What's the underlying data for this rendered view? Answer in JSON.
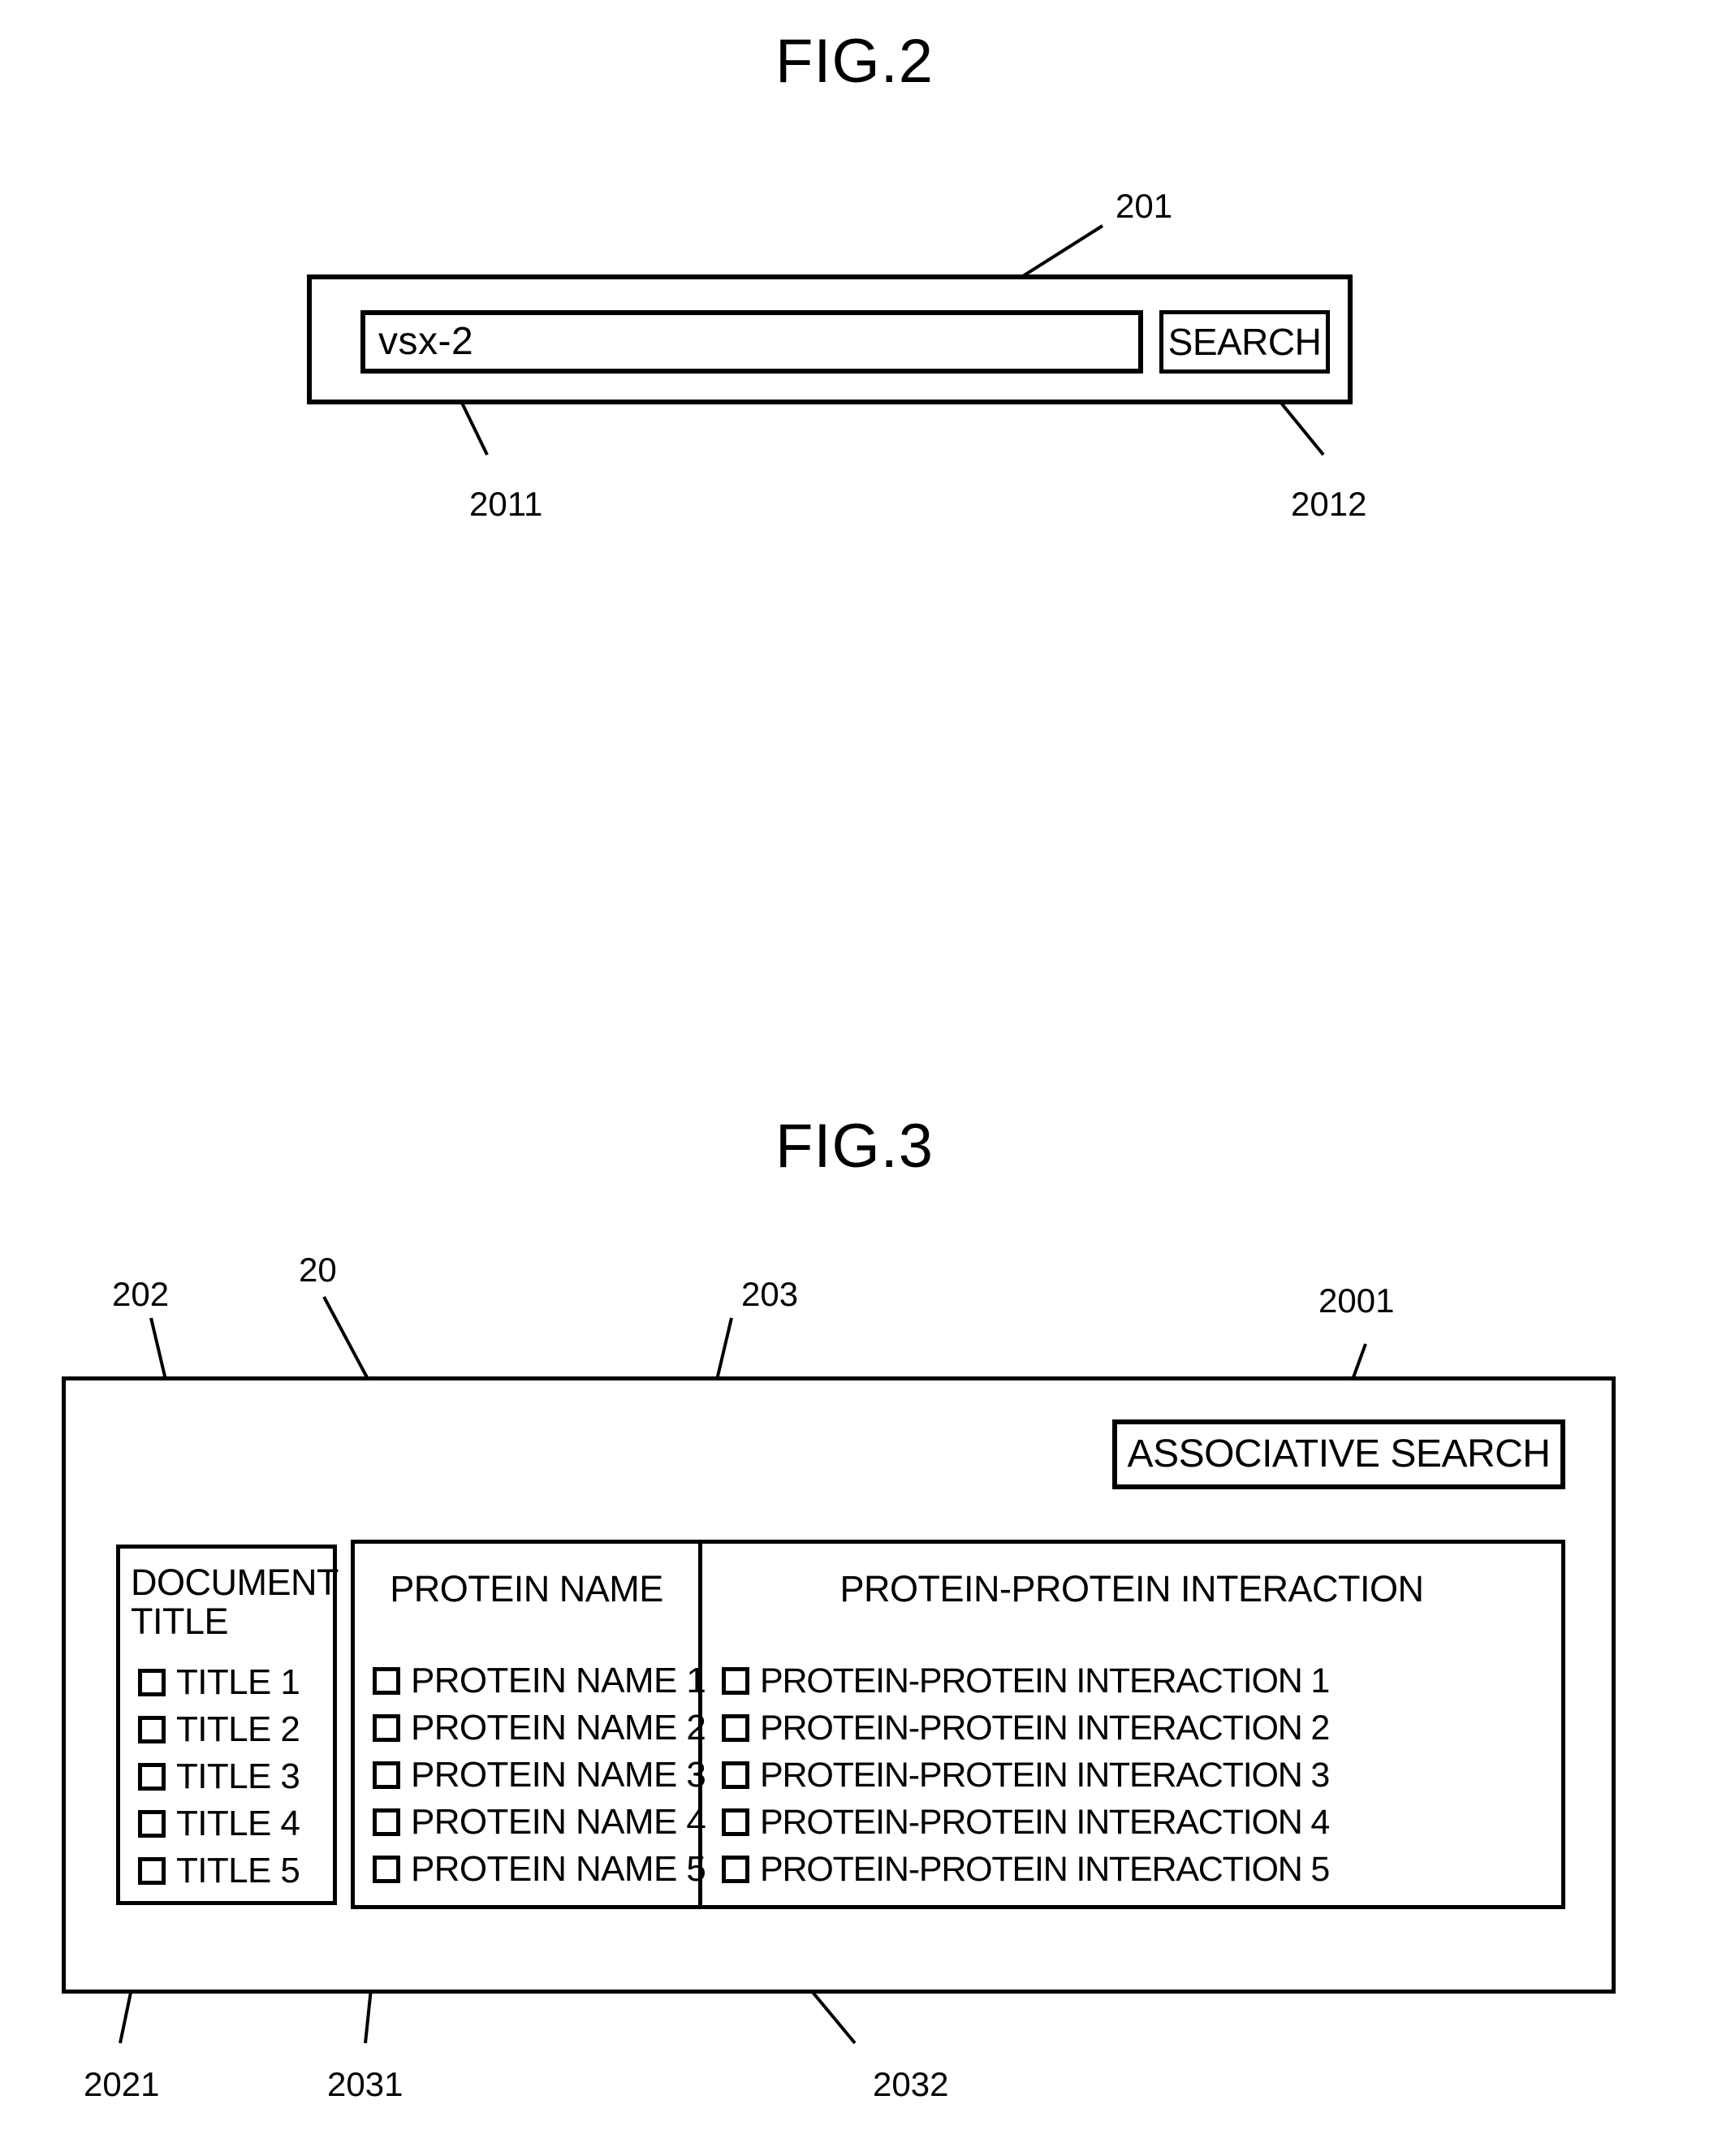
{
  "figures": {
    "fig2": {
      "title": "FIG.2",
      "reference_labels": {
        "window": "201",
        "input_field": "2011",
        "search_button": "2012"
      },
      "search_window": {
        "input_value": "vsx-2",
        "search_button_label": "SEARCH"
      }
    },
    "fig3": {
      "title": "FIG.3",
      "reference_labels": {
        "document_title_panel": "202",
        "window": "20",
        "protein_panel": "203",
        "associative_search_button": "2001",
        "document_title_checkbox": "2021",
        "protein_name_checkbox": "2031",
        "protein_interaction_checkbox": "2032"
      },
      "result_window": {
        "associative_search_label": "ASSOCIATIVE SEARCH",
        "columns": [
          {
            "header": "DOCUMENT TITLE",
            "header_lines": [
              "DOCUMENT",
              "TITLE"
            ],
            "items": [
              "TITLE 1",
              "TITLE 2",
              "TITLE 3",
              "TITLE 4",
              "TITLE 5"
            ]
          },
          {
            "header": "PROTEIN NAME",
            "items": [
              "PROTEIN NAME 1",
              "PROTEIN NAME 2",
              "PROTEIN NAME 3",
              "PROTEIN NAME 4",
              "PROTEIN NAME 5"
            ]
          },
          {
            "header": "PROTEIN-PROTEIN INTERACTION",
            "items": [
              "PROTEIN-PROTEIN INTERACTION 1",
              "PROTEIN-PROTEIN INTERACTION 2",
              "PROTEIN-PROTEIN INTERACTION 3",
              "PROTEIN-PROTEIN INTERACTION 4",
              "PROTEIN-PROTEIN INTERACTION 5"
            ]
          }
        ]
      }
    }
  }
}
